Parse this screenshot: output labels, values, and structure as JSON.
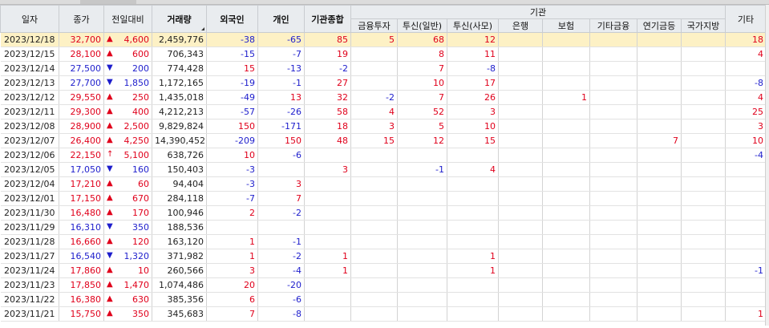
{
  "headers": {
    "date": "일자",
    "close": "종가",
    "change": "전일대비",
    "volume": "거래량",
    "foreign": "외국인",
    "individual": "개인",
    "inst_total": "기관종합",
    "inst_group": "기관",
    "inst_sub": [
      "금융투자",
      "투신(일반)",
      "투신(사모)",
      "은행",
      "보험",
      "기타금융",
      "연기금등",
      "국가지방"
    ],
    "etc": "기타"
  },
  "rows": [
    {
      "date": "2023/12/18",
      "close": "32,700",
      "dir": "up",
      "arrow": "▲",
      "change": "4,600",
      "volume": "2,459,776",
      "foreign": "-38",
      "individual": "-65",
      "inst_total": "85",
      "sub": [
        "5",
        "68",
        "12",
        "",
        "",
        "",
        "",
        ""
      ],
      "etc": "18",
      "selected": true
    },
    {
      "date": "2023/12/15",
      "close": "28,100",
      "dir": "up",
      "arrow": "▲",
      "change": "600",
      "volume": "706,343",
      "foreign": "-15",
      "individual": "-7",
      "inst_total": "19",
      "sub": [
        "",
        "8",
        "11",
        "",
        "",
        "",
        "",
        ""
      ],
      "etc": "4"
    },
    {
      "date": "2023/12/14",
      "close": "27,500",
      "dir": "dn",
      "arrow": "▼",
      "change": "200",
      "volume": "774,428",
      "foreign": "15",
      "individual": "-13",
      "inst_total": "-2",
      "sub": [
        "",
        "7",
        "-8",
        "",
        "",
        "",
        "",
        ""
      ],
      "etc": ""
    },
    {
      "date": "2023/12/13",
      "close": "27,700",
      "dir": "dn",
      "arrow": "▼",
      "change": "1,850",
      "volume": "1,172,165",
      "foreign": "-19",
      "individual": "-1",
      "inst_total": "27",
      "sub": [
        "",
        "10",
        "17",
        "",
        "",
        "",
        "",
        ""
      ],
      "etc": "-8"
    },
    {
      "date": "2023/12/12",
      "close": "29,550",
      "dir": "up",
      "arrow": "▲",
      "change": "250",
      "volume": "1,435,018",
      "foreign": "-49",
      "individual": "13",
      "inst_total": "32",
      "sub": [
        "-2",
        "7",
        "26",
        "",
        "1",
        "",
        "",
        ""
      ],
      "etc": "4"
    },
    {
      "date": "2023/12/11",
      "close": "29,300",
      "dir": "up",
      "arrow": "▲",
      "change": "400",
      "volume": "4,212,213",
      "foreign": "-57",
      "individual": "-26",
      "inst_total": "58",
      "sub": [
        "4",
        "52",
        "3",
        "",
        "",
        "",
        "",
        ""
      ],
      "etc": "25"
    },
    {
      "date": "2023/12/08",
      "close": "28,900",
      "dir": "up",
      "arrow": "▲",
      "change": "2,500",
      "volume": "9,829,824",
      "foreign": "150",
      "individual": "-171",
      "inst_total": "18",
      "sub": [
        "3",
        "5",
        "10",
        "",
        "",
        "",
        "",
        ""
      ],
      "etc": "3"
    },
    {
      "date": "2023/12/07",
      "close": "26,400",
      "dir": "up",
      "arrow": "▲",
      "change": "4,250",
      "volume": "14,390,452",
      "foreign": "-209",
      "individual": "150",
      "inst_total": "48",
      "sub": [
        "15",
        "12",
        "15",
        "",
        "",
        "",
        "7",
        ""
      ],
      "etc": "10"
    },
    {
      "date": "2023/12/06",
      "close": "22,150",
      "dir": "up",
      "arrow": "↑",
      "change": "5,100",
      "volume": "638,726",
      "foreign": "10",
      "individual": "-6",
      "inst_total": "",
      "sub": [
        "",
        "",
        "",
        "",
        "",
        "",
        "",
        ""
      ],
      "etc": "-4"
    },
    {
      "date": "2023/12/05",
      "close": "17,050",
      "dir": "dn",
      "arrow": "▼",
      "change": "160",
      "volume": "150,403",
      "foreign": "-3",
      "individual": "",
      "inst_total": "3",
      "sub": [
        "",
        "-1",
        "4",
        "",
        "",
        "",
        "",
        ""
      ],
      "etc": ""
    },
    {
      "date": "2023/12/04",
      "close": "17,210",
      "dir": "up",
      "arrow": "▲",
      "change": "60",
      "volume": "94,404",
      "foreign": "-3",
      "individual": "3",
      "inst_total": "",
      "sub": [
        "",
        "",
        "",
        "",
        "",
        "",
        "",
        ""
      ],
      "etc": ""
    },
    {
      "date": "2023/12/01",
      "close": "17,150",
      "dir": "up",
      "arrow": "▲",
      "change": "670",
      "volume": "284,118",
      "foreign": "-7",
      "individual": "7",
      "inst_total": "",
      "sub": [
        "",
        "",
        "",
        "",
        "",
        "",
        "",
        ""
      ],
      "etc": ""
    },
    {
      "date": "2023/11/30",
      "close": "16,480",
      "dir": "up",
      "arrow": "▲",
      "change": "170",
      "volume": "100,946",
      "foreign": "2",
      "individual": "-2",
      "inst_total": "",
      "sub": [
        "",
        "",
        "",
        "",
        "",
        "",
        "",
        ""
      ],
      "etc": ""
    },
    {
      "date": "2023/11/29",
      "close": "16,310",
      "dir": "dn",
      "arrow": "▼",
      "change": "350",
      "volume": "188,536",
      "foreign": "",
      "individual": "",
      "inst_total": "",
      "sub": [
        "",
        "",
        "",
        "",
        "",
        "",
        "",
        ""
      ],
      "etc": ""
    },
    {
      "date": "2023/11/28",
      "close": "16,660",
      "dir": "up",
      "arrow": "▲",
      "change": "120",
      "volume": "163,120",
      "foreign": "1",
      "individual": "-1",
      "inst_total": "",
      "sub": [
        "",
        "",
        "",
        "",
        "",
        "",
        "",
        ""
      ],
      "etc": ""
    },
    {
      "date": "2023/11/27",
      "close": "16,540",
      "dir": "dn",
      "arrow": "▼",
      "change": "1,320",
      "volume": "371,982",
      "foreign": "1",
      "individual": "-2",
      "inst_total": "1",
      "sub": [
        "",
        "",
        "1",
        "",
        "",
        "",
        "",
        ""
      ],
      "etc": ""
    },
    {
      "date": "2023/11/24",
      "close": "17,860",
      "dir": "up",
      "arrow": "▲",
      "change": "10",
      "volume": "260,566",
      "foreign": "3",
      "individual": "-4",
      "inst_total": "1",
      "sub": [
        "",
        "",
        "1",
        "",
        "",
        "",
        "",
        ""
      ],
      "etc": "-1"
    },
    {
      "date": "2023/11/23",
      "close": "17,850",
      "dir": "up",
      "arrow": "▲",
      "change": "1,470",
      "volume": "1,074,486",
      "foreign": "20",
      "individual": "-20",
      "inst_total": "",
      "sub": [
        "",
        "",
        "",
        "",
        "",
        "",
        "",
        ""
      ],
      "etc": ""
    },
    {
      "date": "2023/11/22",
      "close": "16,380",
      "dir": "up",
      "arrow": "▲",
      "change": "630",
      "volume": "385,356",
      "foreign": "6",
      "individual": "-6",
      "inst_total": "",
      "sub": [
        "",
        "",
        "",
        "",
        "",
        "",
        "",
        ""
      ],
      "etc": ""
    },
    {
      "date": "2023/11/21",
      "close": "15,750",
      "dir": "up",
      "arrow": "▲",
      "change": "350",
      "volume": "345,683",
      "foreign": "7",
      "individual": "-8",
      "inst_total": "",
      "sub": [
        "",
        "",
        "",
        "",
        "",
        "",
        "",
        ""
      ],
      "etc": "1"
    }
  ],
  "colors": {
    "up": "#e0001b",
    "down": "#1d1dcc",
    "selected_row": "#fdf1c5",
    "header_bg": "#e9ecef"
  }
}
